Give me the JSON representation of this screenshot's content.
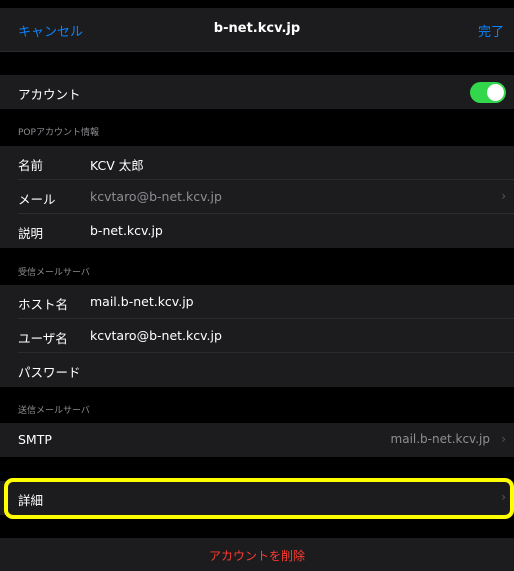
{
  "navbar": {
    "cancel_label": "キャンセル",
    "title": "b-net.kcv.jp",
    "done_label": "完了"
  },
  "account_row": {
    "label": "アカウント",
    "toggle_on": true
  },
  "pop_section": {
    "header": "POPアカウント情報",
    "rows": [
      {
        "label": "名前",
        "value": "KCV 太郎"
      },
      {
        "label": "メール",
        "value": "kcvtaro@b-net.kcv.jp"
      },
      {
        "label": "説明",
        "value": "b-net.kcv.jp"
      }
    ]
  },
  "incoming_section": {
    "header": "受信メールサーバ",
    "rows": [
      {
        "label": "ホスト名",
        "value": "mail.b-net.kcv.jp"
      },
      {
        "label": "ユーザ名",
        "value": "kcvtaro@b-net.kcv.jp"
      },
      {
        "label": "パスワード",
        "value": ""
      }
    ]
  },
  "outgoing_section": {
    "header": "送信メールサーバ",
    "smtp_label": "SMTP",
    "smtp_value": "mail.b-net.kcv.jp"
  },
  "advanced_row": {
    "label": "詳細"
  },
  "delete_label": "アカウントを削除",
  "colors": {
    "accent": "#0a84ff",
    "toggle_on": "#32d74b",
    "destructive": "#ff3b30",
    "highlight": "#ffff00"
  }
}
